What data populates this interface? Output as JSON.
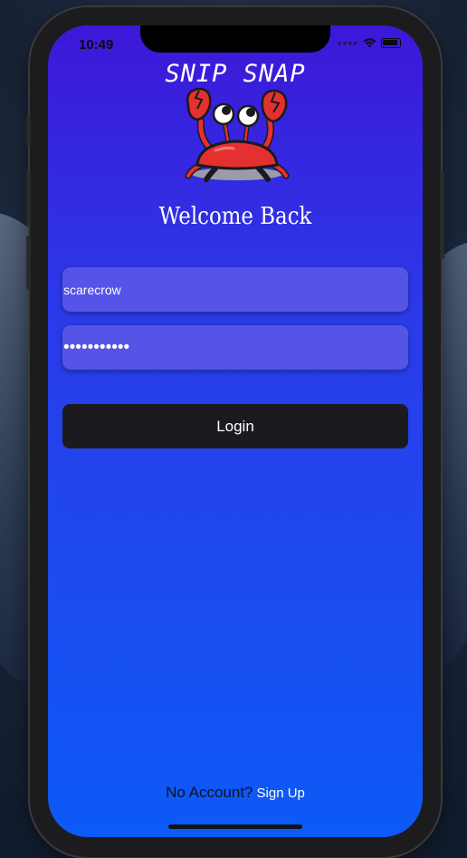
{
  "status_bar": {
    "time": "10:49",
    "signal_icon": "signal-dots-icon",
    "wifi_icon": "wifi-icon",
    "battery_icon": "battery-icon"
  },
  "app": {
    "title": "SNIP SNAP",
    "logo_icon": "crab-icon",
    "welcome": "Welcome Back"
  },
  "form": {
    "username_value": "scarecrow",
    "password_value": "•••••••••••",
    "login_label": "Login"
  },
  "footer": {
    "prompt": "No Account?",
    "signup_label": "Sign Up"
  },
  "colors": {
    "gradient_top": "#3d17d8",
    "gradient_bottom": "#0c5af7",
    "field_bg": "#5454e9",
    "button_bg": "#1b1b1f"
  }
}
